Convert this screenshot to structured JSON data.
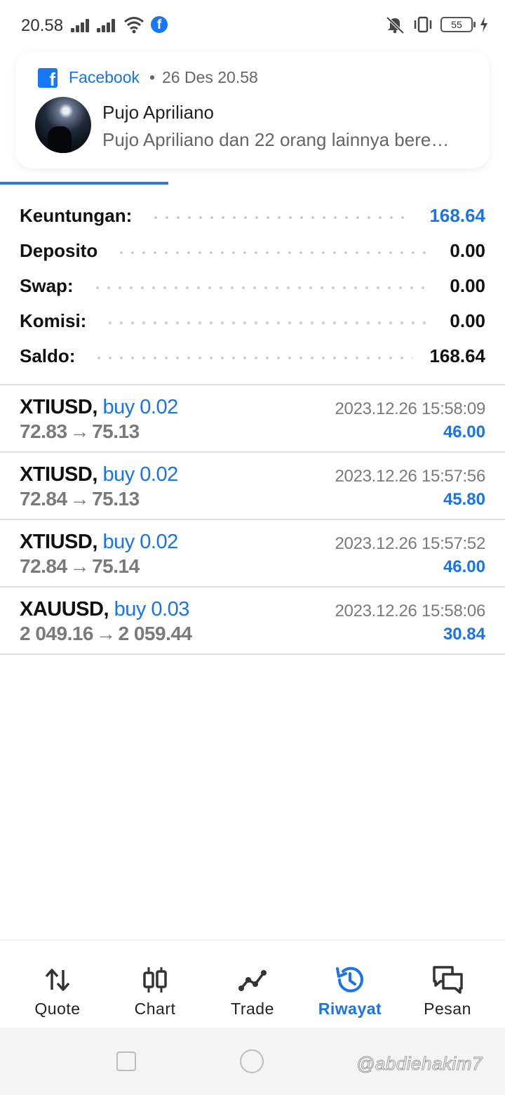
{
  "status_bar": {
    "time": "20.58",
    "battery": "55"
  },
  "notification": {
    "app": "Facebook",
    "separator": "•",
    "time": "26 Des 20.58",
    "title": "Pujo Apriliano",
    "body": "Pujo Apriliano dan 22 orang lainnya bere…"
  },
  "summary": [
    {
      "label": "Keuntungan:",
      "value": "168.64",
      "highlight": true
    },
    {
      "label": "Deposito",
      "value": "0.00",
      "highlight": false
    },
    {
      "label": "Swap:",
      "value": "0.00",
      "highlight": false
    },
    {
      "label": "Komisi:",
      "value": "0.00",
      "highlight": false
    },
    {
      "label": "Saldo:",
      "value": "168.64",
      "highlight": false
    }
  ],
  "deals": [
    {
      "symbol": "XTIUSD,",
      "side": "buy 0.02",
      "open": "72.83",
      "close": "75.13",
      "time": "2023.12.26 15:58:09",
      "profit": "46.00"
    },
    {
      "symbol": "XTIUSD,",
      "side": "buy 0.02",
      "open": "72.84",
      "close": "75.13",
      "time": "2023.12.26 15:57:56",
      "profit": "45.80"
    },
    {
      "symbol": "XTIUSD,",
      "side": "buy 0.02",
      "open": "72.84",
      "close": "75.14",
      "time": "2023.12.26 15:57:52",
      "profit": "46.00"
    },
    {
      "symbol": "XAUUSD,",
      "side": "buy 0.03",
      "open": "2 049.16",
      "close": "2 059.44",
      "time": "2023.12.26 15:58:06",
      "profit": "30.84"
    }
  ],
  "arrow": "→",
  "nav": [
    {
      "label": "Quote",
      "icon": "quote-arrows-icon"
    },
    {
      "label": "Chart",
      "icon": "candlestick-icon"
    },
    {
      "label": "Trade",
      "icon": "trade-line-icon"
    },
    {
      "label": "Riwayat",
      "icon": "history-icon",
      "active": true
    },
    {
      "label": "Pesan",
      "icon": "chat-bubbles-icon"
    }
  ],
  "watermark": "@abdiehakim7",
  "colors": {
    "accent": "#1a73e8",
    "facebook": "#1877f2",
    "muted": "#7a7a7a"
  }
}
